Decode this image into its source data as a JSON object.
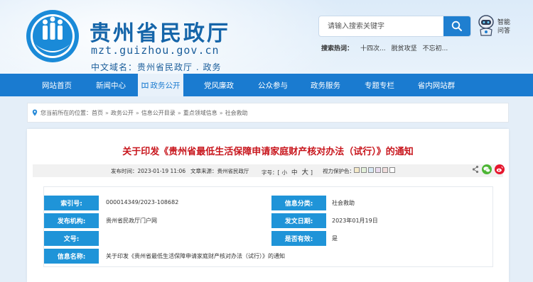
{
  "header": {
    "title": "贵州省民政厅",
    "domain": "mzt.guizhou.gov.cn",
    "cn_domain": "中文域名：贵州省民政厅 . 政务",
    "search_placeholder": "请输入搜索关键字",
    "assistant_label": "智能问答",
    "hot_label": "搜索热词：",
    "hot_terms": [
      "十四次...",
      "脱贫攻坚",
      "不忘初..."
    ]
  },
  "nav": {
    "items": [
      "网站首页",
      "新闻中心",
      "政务公开",
      "党风廉政",
      "公众参与",
      "政务服务",
      "专题专栏",
      "省内网站群"
    ],
    "active_index": 2
  },
  "breadcrumb": {
    "prefix": "您当前所在的位置：",
    "items": [
      "首页",
      "政务公开",
      "信息公开目录",
      "重点领域信息",
      "社会救助"
    ],
    "separator": "»"
  },
  "document": {
    "title": "关于印发《贵州省最低生活保障申请家庭财产核对办法（试行）》的通知",
    "published_label": "发布时间：",
    "published": "2023-01-19 11:06",
    "source_label": "文章来源：",
    "source": "贵州省民政厅",
    "font_label": "字号：",
    "font_open": "[",
    "font_small": "小",
    "font_medium": "中",
    "font_large": "大",
    "font_close": "]",
    "eye_label": "视力保护色：",
    "eye_colors": [
      "#f5e9c8",
      "#e2f0d9",
      "#d8e8f5",
      "#e9dcef",
      "#f0dcdc",
      "#ffffff"
    ]
  },
  "info": {
    "index_label": "索引号:",
    "index_value": "000014349/2023-108682",
    "category_label": "信息分类:",
    "category_value": "社会救助",
    "publisher_label": "发布机构:",
    "publisher_value": "贵州省民政厅门户网",
    "date_label": "发文日期:",
    "date_value": "2023年01月19日",
    "docno_label": "文号:",
    "docno_value": "",
    "valid_label": "是否有效:",
    "valid_value": "是",
    "name_label": "信息名称:",
    "name_value": "关于印发《贵州省最低生活保障申请家庭财产核对办法（试行）》的通知"
  }
}
